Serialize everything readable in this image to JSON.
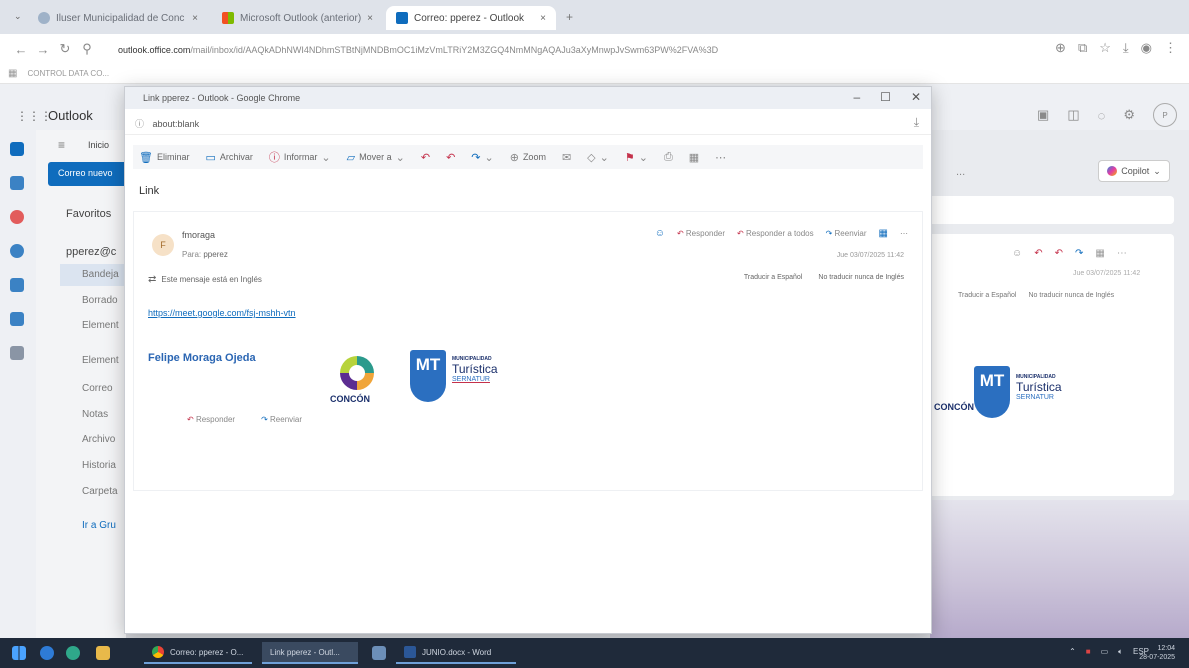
{
  "browser": {
    "tabs": [
      {
        "label": "Iluser Municipalidad de Conc"
      },
      {
        "label": "Microsoft Outlook (anterior)"
      },
      {
        "label": "Correo: pperez - Outlook"
      }
    ],
    "url_host": "outlook.office.com",
    "url_path": "/mail/inbox/id/AAQkADhNWI4NDhmSTBtNjMNDBmOC1iMzVmLTRiY2M3ZGQ4NmMNgAQAJu3aXyMnwpJvSwm63PW%2FVA%3D",
    "bookmark": "CONTROL DATA CO..."
  },
  "outlook": {
    "brand": "Outlook",
    "tab_inicio": "Inicio",
    "new_mail": "Correo nuevo",
    "favorites": "Favoritos",
    "account": "pperez@c",
    "folders": [
      "Bandeja",
      "Borrado",
      "Element",
      "Element",
      "Correo",
      "Notas",
      "Archivo",
      "Historia",
      "Carpeta"
    ],
    "go_groups": "Ir a Gru",
    "copilot": "Copilot",
    "more": "..."
  },
  "popup": {
    "window_title": "Link pperez - Outlook - Google Chrome",
    "address": "about:blank",
    "toolbar": {
      "delete": "Eliminar",
      "archive": "Archivar",
      "report": "Informar",
      "move": "Mover a",
      "zoom": "Zoom"
    },
    "subject": "Link",
    "message": {
      "avatar": "F",
      "sender": "fmoraga",
      "to_label": "Para:",
      "to": "pperez",
      "reply": "Responder",
      "reply_all": "Responder a todos",
      "forward": "Reenviar",
      "date": "Jue 03/07/2025 11:42",
      "lang_notice": "Este mensaje está en Inglés",
      "translate": "Traducir a Español",
      "never_translate": "No traducir nunca de Inglés",
      "link": "https://meet.google.com/fsj-mshh-vtn",
      "signature_name": "Felipe Moraga Ojeda",
      "logo_concon": "CONCÓN",
      "logo_mt_small": "MUNICIPALIDAD",
      "logo_mt_big": "Turística",
      "logo_sernatur": "SERNATUR",
      "logo_mt_letters": "MT"
    },
    "reply_bottom": "Responder",
    "forward_bottom": "Reenviar"
  },
  "background_pane": {
    "date": "Jue 03/07/2025 11:42",
    "translate": "Traducir a Español",
    "never_translate": "No traducir nunca de Inglés",
    "concon": "CONCÓN"
  },
  "taskbar": {
    "apps": [
      {
        "label": "Correo: pperez - O..."
      },
      {
        "label": "Link pperez - Outl..."
      },
      {
        "label": "JUNIO.docx - Word"
      }
    ],
    "lang": "ESP",
    "time": "12:04",
    "date": "28-07-2025"
  },
  "colors": {
    "accent": "#0f6cbd",
    "danger": "#c4314b",
    "taskbar": "#1f2a3a"
  }
}
